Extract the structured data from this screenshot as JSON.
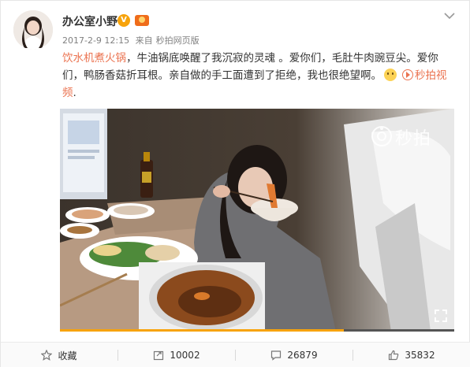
{
  "post": {
    "author": "办公室小野",
    "date": "2017-2-9 12:15",
    "from_prefix": "来自",
    "source": "秒拍网页版",
    "hashtag": "饮水机煮火锅",
    "text_part1": "，牛油锅底唤醒了我沉寂的灵魂 。爱你们，毛肚牛肉豌豆尖。爱你们，鸭肠香菇折耳根。亲自做的手工面遭到了拒绝，我也很绝望啊。",
    "link_text": "秒拍视频",
    "link_tail": "."
  },
  "video": {
    "watermark": "秒拍",
    "progress": 0.72
  },
  "actions": {
    "favorite": "收藏",
    "repost": "10002",
    "comment": "26879",
    "like": "35832"
  },
  "colors": {
    "accent": "#eb7350",
    "badge": "#f7a30b"
  }
}
